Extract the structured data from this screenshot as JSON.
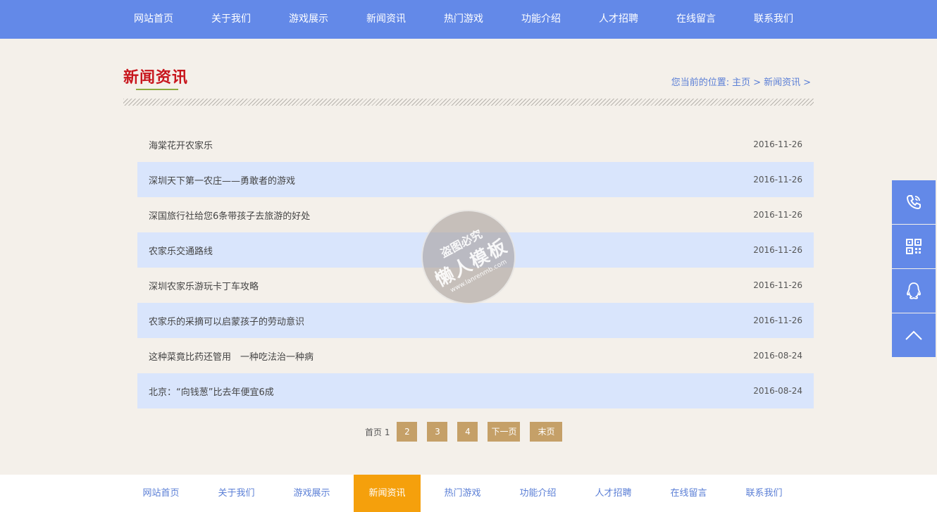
{
  "top_nav": [
    "网站首页",
    "关于我们",
    "游戏展示",
    "新闻资讯",
    "热门游戏",
    "功能介绍",
    "人才招聘",
    "在线留言",
    "联系我们"
  ],
  "page_title": "新闻资讯",
  "breadcrumb": {
    "prefix": "您当前的位置:",
    "home": "主页",
    "sep1": ">",
    "current": "新闻资讯",
    "sep2": ">"
  },
  "news": [
    {
      "title": "海棠花开农家乐",
      "date": "2016-11-26"
    },
    {
      "title": "深圳天下第一农庄——勇敢者的游戏",
      "date": "2016-11-26"
    },
    {
      "title": "深国旅行社给您6条带孩子去旅游的好处",
      "date": "2016-11-26"
    },
    {
      "title": "农家乐交通路线",
      "date": "2016-11-26"
    },
    {
      "title": "深圳农家乐游玩卡丁车攻略",
      "date": "2016-11-26"
    },
    {
      "title": "农家乐的采摘可以启蒙孩子的劳动意识",
      "date": "2016-11-26"
    },
    {
      "title": "这种菜竟比药还管用　一种吃法治一种病",
      "date": "2016-08-24"
    },
    {
      "title": "北京：“向钱葱”比去年便宜6成",
      "date": "2016-08-24"
    }
  ],
  "pager": {
    "first": "首页",
    "current": "1",
    "pages": [
      "2",
      "3",
      "4"
    ],
    "next": "下一页",
    "last": "末页"
  },
  "watermark": {
    "top": "盗图必究",
    "main": "懒人模板",
    "url": "www.lanrenmb.com"
  },
  "side_tools": [
    "phone-icon",
    "qrcode-icon",
    "qq-icon",
    "back-to-top-icon"
  ],
  "footer_nav": [
    "网站首页",
    "关于我们",
    "游戏展示",
    "新闻资讯",
    "热门游戏",
    "功能介绍",
    "人才招聘",
    "在线留言",
    "联系我们"
  ],
  "footer_active": "新闻资讯",
  "colors": {
    "nav_bg": "#6389e8",
    "title_red": "#c8171e",
    "row_alt": "#d9e5fc",
    "pager_btn": "#c5a068",
    "footer_active": "#f5a00c",
    "page_bg": "#f4f0ea"
  }
}
